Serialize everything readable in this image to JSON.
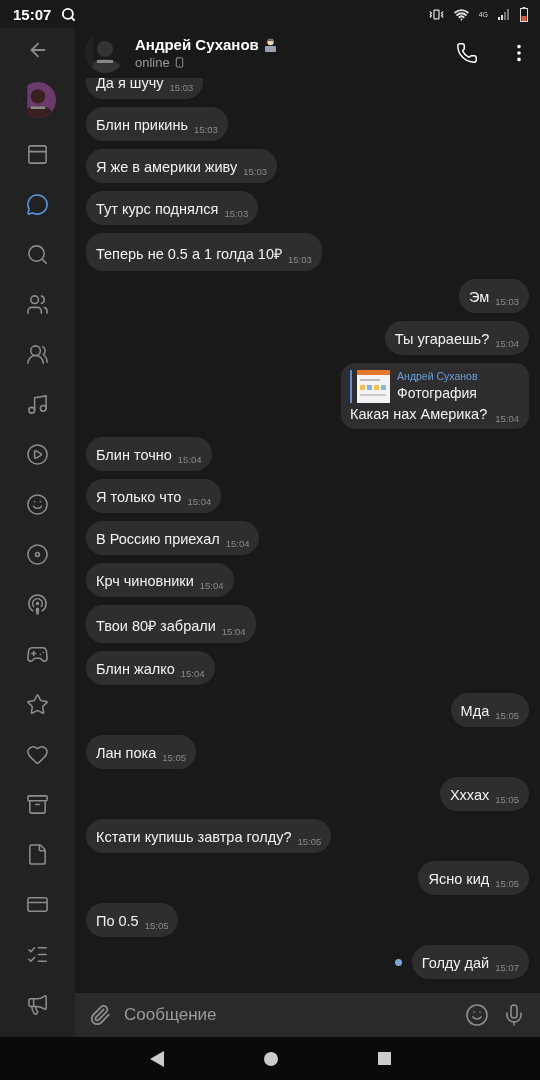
{
  "status_bar": {
    "time": "15:07",
    "network": "4G"
  },
  "sidebar": {
    "items": [
      {
        "selected": false
      },
      {
        "selected": true
      },
      {
        "selected": false
      },
      {
        "selected": false
      },
      {
        "selected": false
      },
      {
        "selected": false
      },
      {
        "selected": false
      },
      {
        "selected": false
      },
      {
        "selected": false
      },
      {
        "selected": false
      },
      {
        "selected": false
      },
      {
        "selected": false
      },
      {
        "selected": false
      },
      {
        "selected": false
      },
      {
        "selected": false
      },
      {
        "selected": false
      },
      {
        "selected": false
      },
      {
        "selected": false
      }
    ]
  },
  "header": {
    "name": "Андрей Суханов",
    "status": "online"
  },
  "messages": [
    {
      "kind": "incoming",
      "text": "Да я шучу",
      "time": "15:03"
    },
    {
      "kind": "incoming",
      "text": "Блин прикинь",
      "time": "15:03"
    },
    {
      "kind": "incoming",
      "text": "Я же в америки живу",
      "time": "15:03"
    },
    {
      "kind": "incoming",
      "text": "Тут курс поднялся",
      "time": "15:03"
    },
    {
      "kind": "incoming",
      "text": "Теперь не 0.5 а 1 голда 10₽",
      "time": "15:03"
    },
    {
      "kind": "outgoing",
      "text": "Эм",
      "time": "15:03"
    },
    {
      "kind": "outgoing",
      "text": "Ты угараешь?",
      "time": "15:04"
    },
    {
      "kind": "outgoing",
      "text": "Какая нах Америка?",
      "time": "15:04",
      "reply": {
        "author": "Андрей Суханов",
        "text": "Фотография"
      }
    },
    {
      "kind": "incoming",
      "text": "Блин точно",
      "time": "15:04"
    },
    {
      "kind": "incoming",
      "text": "Я только что",
      "time": "15:04"
    },
    {
      "kind": "incoming",
      "text": "В Россию приехал",
      "time": "15:04"
    },
    {
      "kind": "incoming",
      "text": "Крч чиновники",
      "time": "15:04"
    },
    {
      "kind": "incoming",
      "text": "Твои 80₽ забрали",
      "time": "15:04"
    },
    {
      "kind": "incoming",
      "text": "Блин жалко",
      "time": "15:04"
    },
    {
      "kind": "outgoing",
      "text": "Мда",
      "time": "15:05"
    },
    {
      "kind": "incoming",
      "text": "Лан пока",
      "time": "15:05"
    },
    {
      "kind": "outgoing",
      "text": "Хххах",
      "time": "15:05"
    },
    {
      "kind": "incoming",
      "text": "Кстати купишь завтра голду?",
      "time": "15:05"
    },
    {
      "kind": "outgoing",
      "text": "Ясно кид",
      "time": "15:05"
    },
    {
      "kind": "incoming",
      "text": "По 0.5",
      "time": "15:05"
    },
    {
      "kind": "outgoing",
      "text": "Голду дай",
      "time": "15:07",
      "unread": true
    }
  ],
  "composer": {
    "placeholder": "Сообщение"
  }
}
